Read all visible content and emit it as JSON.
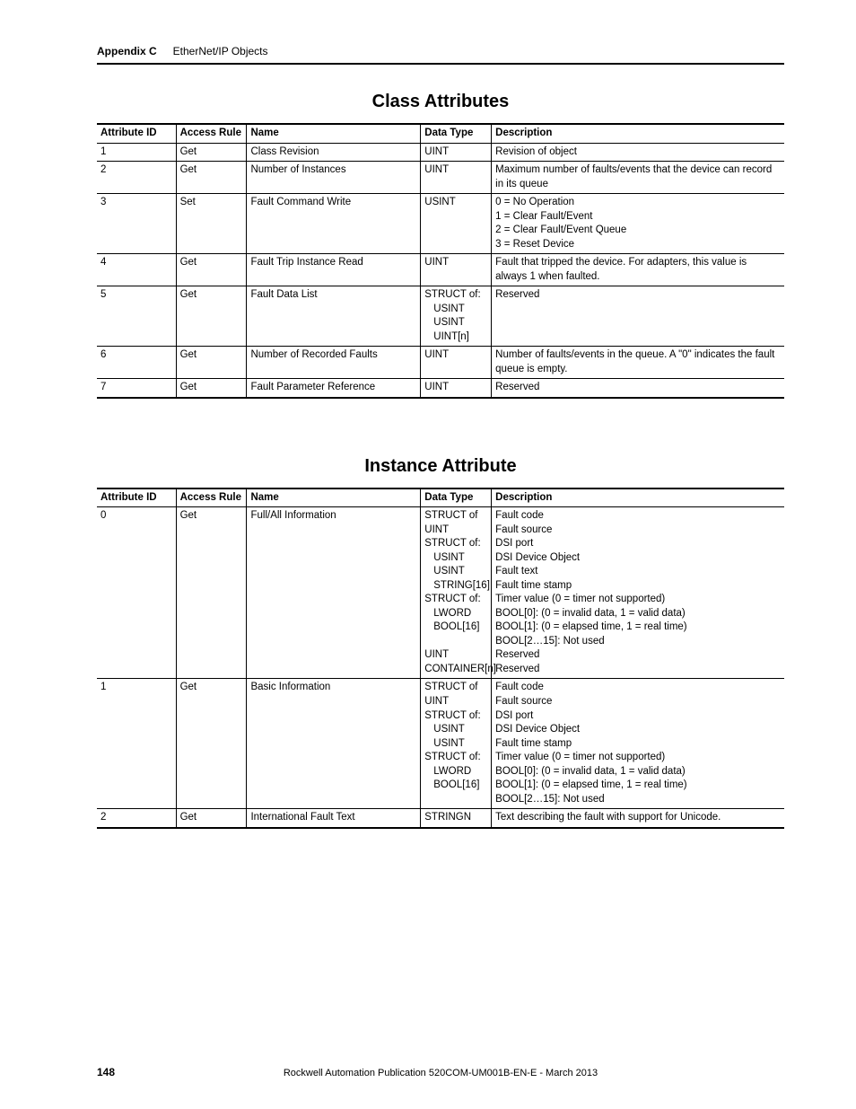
{
  "header": {
    "appendix": "Appendix C",
    "chapter": "EtherNet/IP Objects"
  },
  "section1": {
    "title": "Class Attributes",
    "headers": [
      "Attribute ID",
      "Access Rule",
      "Name",
      "Data Type",
      "Description"
    ],
    "rows": [
      {
        "id": "1",
        "rule": "Get",
        "name": "Class Revision",
        "type": [
          "UINT"
        ],
        "desc": [
          "Revision of object"
        ]
      },
      {
        "id": "2",
        "rule": "Get",
        "name": "Number of Instances",
        "type": [
          "UINT"
        ],
        "desc": [
          "Maximum number of faults/events that the device can record in its queue"
        ]
      },
      {
        "id": "3",
        "rule": "Set",
        "name": "Fault Command Write",
        "type": [
          "USINT"
        ],
        "desc": [
          "0 = No Operation",
          "1 = Clear Fault/Event",
          "2 = Clear Fault/Event Queue",
          "3 = Reset Device"
        ]
      },
      {
        "id": "4",
        "rule": "Get",
        "name": "Fault Trip Instance Read",
        "type": [
          "UINT"
        ],
        "desc": [
          "Fault that tripped the device. For adapters, this value is always 1 when faulted."
        ]
      },
      {
        "id": "5",
        "rule": "Get",
        "name": "Fault Data List",
        "type": [
          "STRUCT of:",
          "  USINT",
          "  USINT",
          "  UINT[n]"
        ],
        "desc": [
          "Reserved"
        ]
      },
      {
        "id": "6",
        "rule": "Get",
        "name": "Number of Recorded Faults",
        "type": [
          "UINT"
        ],
        "desc": [
          "Number of faults/events in the queue. A \"0\" indicates the fault queue is empty."
        ]
      },
      {
        "id": "7",
        "rule": "Get",
        "name": "Fault Parameter Reference",
        "type": [
          "UINT"
        ],
        "desc": [
          "Reserved"
        ]
      }
    ]
  },
  "section2": {
    "title": "Instance Attribute",
    "headers": [
      "Attribute ID",
      "Access Rule",
      "Name",
      "Data Type",
      "Description"
    ],
    "rows": [
      {
        "id": "0",
        "rule": "Get",
        "name": "Full/All Information",
        "type": [
          "STRUCT of UINT",
          "STRUCT of:",
          "  USINT",
          "  USINT",
          "  STRING[16]",
          "STRUCT of:",
          "  LWORD",
          "  BOOL[16]",
          " ",
          "UINT",
          "CONTAINER[n]"
        ],
        "desc": [
          "Fault code",
          "Fault source",
          "DSI port",
          "DSI Device Object",
          "Fault text",
          "Fault time stamp",
          "Timer value (0 = timer not supported)",
          "BOOL[0]: (0 = invalid data, 1 = valid data)",
          "BOOL[1]: (0 = elapsed time, 1 = real time)",
          "BOOL[2…15]: Not used",
          "Reserved",
          "Reserved"
        ]
      },
      {
        "id": "1",
        "rule": "Get",
        "name": "Basic Information",
        "type": [
          "STRUCT of UINT",
          "STRUCT of:",
          "  USINT",
          "  USINT",
          "STRUCT of:",
          "  LWORD",
          "  BOOL[16]"
        ],
        "desc": [
          "Fault code",
          "Fault source",
          "DSI port",
          "DSI Device Object",
          "Fault time stamp",
          "Timer value (0 = timer not supported)",
          "BOOL[0]: (0 = invalid data, 1 = valid data)",
          "BOOL[1]: (0 = elapsed time, 1 = real time)",
          "BOOL[2…15]: Not used"
        ]
      },
      {
        "id": "2",
        "rule": "Get",
        "name": "International Fault Text",
        "type": [
          "STRINGN"
        ],
        "desc": [
          "Text describing the fault with support for Unicode."
        ]
      }
    ]
  },
  "footer": {
    "page": "148",
    "publication": "Rockwell Automation Publication 520COM-UM001B-EN-E - March 2013"
  }
}
